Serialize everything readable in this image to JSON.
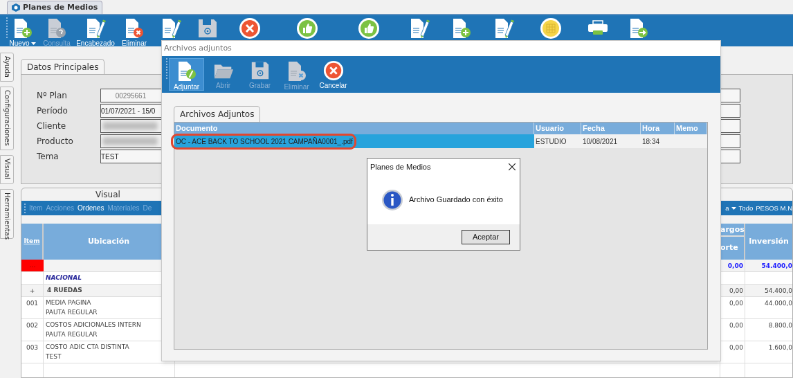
{
  "app_tab": {
    "title": "Planes de Medios"
  },
  "toolbar": {
    "buttons": [
      {
        "label": "Nuevo",
        "dropdown": true,
        "disabled": false
      },
      {
        "label": "Consulta",
        "dropdown": false,
        "disabled": true
      },
      {
        "label": "Encabezado",
        "dropdown": false,
        "disabled": false
      },
      {
        "label": "Eliminar",
        "dropdown": false,
        "disabled": false
      }
    ]
  },
  "side_tabs": [
    "Ayuda",
    "Configuraciones",
    "Visual",
    "Herramientas"
  ],
  "datos_principales": {
    "title": "Datos Principales",
    "fields": [
      {
        "label": "Nº Plan",
        "kind": "readonly",
        "value": "00295661"
      },
      {
        "label": "Período",
        "kind": "text",
        "value": "01/07/2021 - 15/0"
      },
      {
        "label": "Cliente",
        "kind": "redacted"
      },
      {
        "label": "Producto",
        "kind": "redacted"
      },
      {
        "label": "Tema",
        "kind": "text",
        "value": "TEST"
      }
    ]
  },
  "visual": {
    "title": "Visual",
    "menu": [
      {
        "label": "Item",
        "selected": false
      },
      {
        "label": "Acciones",
        "selected": false
      },
      {
        "label": "Ordenes",
        "selected": true
      },
      {
        "label": "Materiales",
        "selected": false
      },
      {
        "label": "De",
        "selected": false
      }
    ],
    "menu_right": [
      {
        "label": "a",
        "dropdown": true
      },
      {
        "label": "Todo",
        "dropdown": false
      },
      {
        "label": "PESOS M.N",
        "dropdown": false
      }
    ],
    "table": {
      "columns": {
        "item": "Item",
        "ubicacion": "Ubicación",
        "group": "argos",
        "sub": "orte",
        "inversion": "Inversión"
      },
      "rows": [
        {
          "kind": "marker",
          "item": "...",
          "lines": [],
          "values": [
            "0,00",
            "54.400,0"
          ]
        },
        {
          "kind": "group",
          "item": "",
          "lines": [
            "NACIONAL"
          ],
          "values": []
        },
        {
          "kind": "subgroup",
          "item": "+",
          "lines": [
            "4 RUEDAS"
          ],
          "values": [
            "0,00",
            "54.400,0"
          ]
        },
        {
          "kind": "line",
          "item": "001",
          "lines": [
            "MEDIA PAGINA",
            "PAUTA REGULAR"
          ],
          "values": [
            "0,00",
            "44.000,0"
          ]
        },
        {
          "kind": "line",
          "item": "002",
          "lines": [
            "COSTOS ADICIONALES INTERN",
            "PAUTA REGULAR"
          ],
          "values": [
            "0,00",
            "8.800,0"
          ]
        },
        {
          "kind": "line",
          "item": "003",
          "lines": [
            "COSTO ADIC CTA DISTINTA",
            "TEST"
          ],
          "values": [
            "0,00",
            "1.600,0"
          ]
        }
      ]
    }
  },
  "dialog": {
    "title": "Archivos adjuntos",
    "toolbar": [
      {
        "label": "Adjuntar",
        "selected": true,
        "disabled": false
      },
      {
        "label": "Abrir",
        "selected": false,
        "disabled": true
      },
      {
        "label": "Grabar",
        "selected": false,
        "disabled": true
      },
      {
        "label": "Eliminar",
        "selected": false,
        "disabled": true
      },
      {
        "label": "Cancelar",
        "selected": false,
        "disabled": false
      }
    ],
    "tab": "Archivos Adjuntos",
    "table": {
      "columns": [
        "Documento",
        "Usuario",
        "Fecha",
        "Hora",
        "Memo"
      ],
      "rows": [
        {
          "cells": [
            "OC - ACE BACK TO SCHOOL 2021 CAMPAÑA0001_.pdf",
            "ESTUDIO",
            "10/08/2021",
            "18:34"
          ],
          "selected": true,
          "circled": true
        }
      ]
    }
  },
  "message_box": {
    "title": "Planes de Medios",
    "kind": "info",
    "message": "Archivo Guardado con éxito",
    "button": "Aceptar"
  }
}
